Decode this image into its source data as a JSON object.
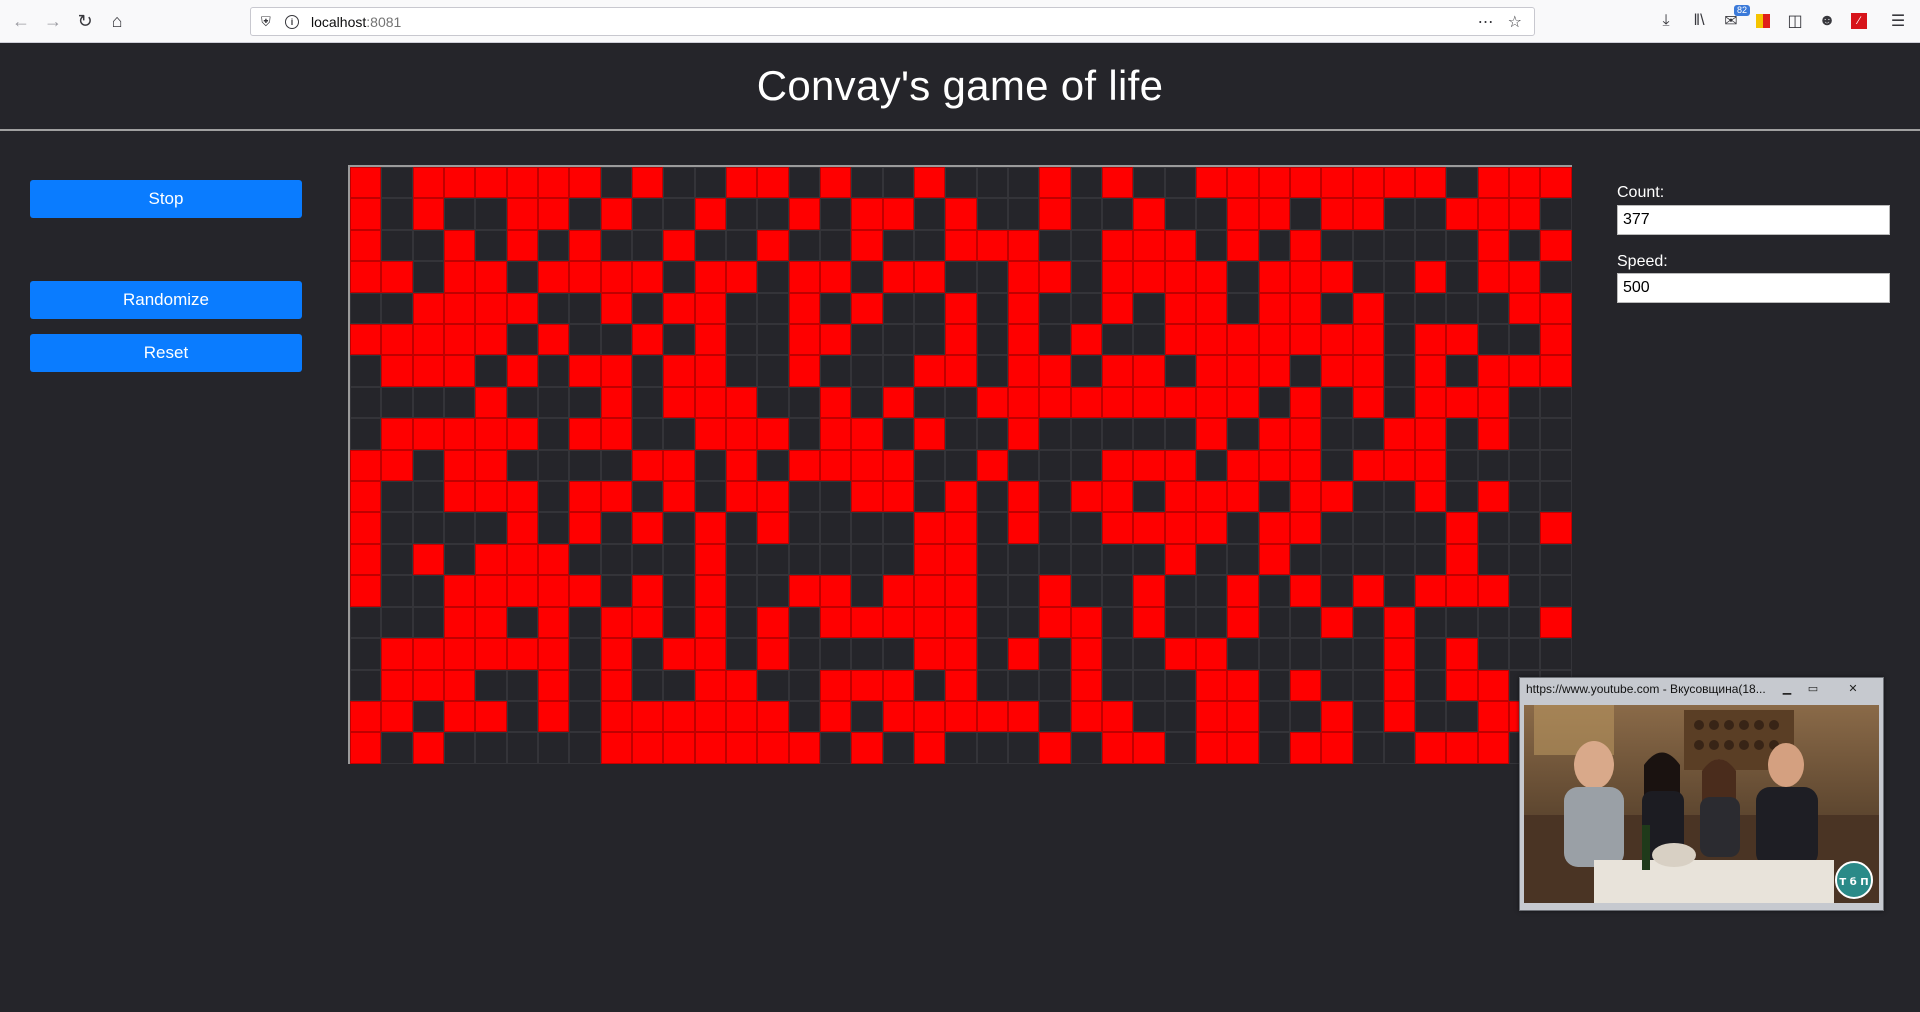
{
  "browser": {
    "url_host": "localhost",
    "url_port": ":8081",
    "badge_count": "82"
  },
  "page": {
    "title": "Convay's game of life"
  },
  "buttons": {
    "stop": "Stop",
    "randomize": "Randomize",
    "reset": "Reset"
  },
  "stats": {
    "count_label": "Count:",
    "count_value": "377",
    "speed_label": "Speed:",
    "speed_value": "500"
  },
  "pip": {
    "title": "https://www.youtube.com - Вкусовщина(18...",
    "minimize": "▁",
    "restore": "▭",
    "close": "✕",
    "logo_text": "Т б П"
  },
  "colors": {
    "alive": "#ff0000",
    "dead": "#25252a",
    "accent": "#0a7cff"
  },
  "grid": {
    "columns": 39,
    "rows": 19,
    "cells": [
      "1011111101001101001000101001111111101111011",
      "1010011010010010110100100100110110011100",
      "1001010100100100100111001110101000001011",
      "1101101111011011011001101111011100101100011",
      "0011110010110010100101001011011010000111",
      "1111101001010011000101010011111110110011",
      "0111010110110010001101101101110110101111",
      "0000100010111001010011111111101010111001",
      "0111110110011101101001000001011001101001",
      "1101100001101011110010001110111011100000",
      "1001110110101100110101011011101100101001",
      "1000010101010100001101001111011000010011",
      "1010111000010000001100000010010000010001",
      "1001111101010011011100100100101010111001",
      "0001101011010101111100110100100101000011",
      "0111111010110100001101010011000001010001",
      "0111001010011001110100010001101001011000",
      "1101101011111101011111011001100101001101",
      "1010000011111110101000101101101100111011"
    ]
  }
}
